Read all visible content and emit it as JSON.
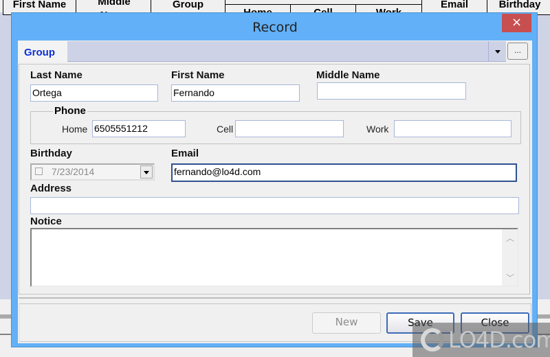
{
  "background_table": {
    "headers": [
      "First Name",
      "Middle Name",
      "Group",
      "Email",
      "Birthday"
    ],
    "phone_subheaders": [
      "Home",
      "Cell",
      "Work"
    ]
  },
  "dialog": {
    "title": "Record",
    "close_icon": "×",
    "group": {
      "label": "Group",
      "value": "",
      "browse_label": "..."
    },
    "fields": {
      "last_name": {
        "label": "Last Name",
        "value": "Ortega"
      },
      "first_name": {
        "label": "First Name",
        "value": "Fernando"
      },
      "middle_name": {
        "label": "Middle Name",
        "value": ""
      },
      "phone": {
        "label": "Phone",
        "home": {
          "label": "Home",
          "value": "6505551212"
        },
        "cell": {
          "label": "Cell",
          "value": ""
        },
        "work": {
          "label": "Work",
          "value": ""
        }
      },
      "birthday": {
        "label": "Birthday",
        "value": "7/23/2014",
        "checked": false
      },
      "email": {
        "label": "Email",
        "value": "fernando@lo4d.com"
      },
      "address": {
        "label": "Address",
        "value": ""
      },
      "notice": {
        "label": "Notice",
        "value": ""
      }
    },
    "buttons": {
      "new": "New",
      "save": "Save",
      "close": "Close"
    }
  },
  "watermark": {
    "text": "LO4D.com"
  },
  "colors": {
    "title_bar": "#62b0f7",
    "close_button": "#c84f4f",
    "group_label": "#0b2fd4",
    "button_border": "#3a6bb6"
  }
}
